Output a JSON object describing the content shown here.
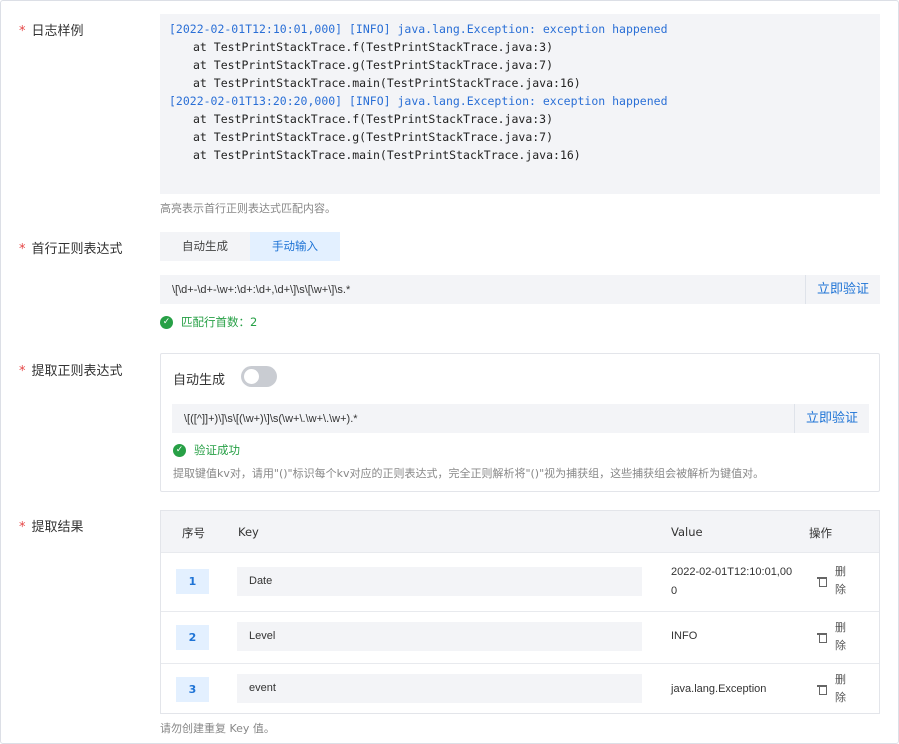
{
  "log_sample": {
    "label": "日志样例",
    "lines": [
      {
        "text": "[2022-02-01T12:10:01,000] [INFO] java.lang.Exception: exception happened",
        "highlight": true
      },
      {
        "text": "at TestPrintStackTrace.f(TestPrintStackTrace.java:3)",
        "highlight": false
      },
      {
        "text": "at TestPrintStackTrace.g(TestPrintStackTrace.java:7)",
        "highlight": false
      },
      {
        "text": "at TestPrintStackTrace.main(TestPrintStackTrace.java:16)",
        "highlight": false
      },
      {
        "text": "[2022-02-01T13:20:20,000] [INFO] java.lang.Exception: exception happened",
        "highlight": true
      },
      {
        "text": "at TestPrintStackTrace.f(TestPrintStackTrace.java:3)",
        "highlight": false
      },
      {
        "text": "at TestPrintStackTrace.g(TestPrintStackTrace.java:7)",
        "highlight": false
      },
      {
        "text": "at TestPrintStackTrace.main(TestPrintStackTrace.java:16)",
        "highlight": false
      }
    ],
    "hint": "高亮表示首行正则表达式匹配内容。"
  },
  "first_line_regex": {
    "label": "首行正则表达式",
    "tabs": [
      {
        "label": "自动生成",
        "active": false
      },
      {
        "label": "手动输入",
        "active": true
      }
    ],
    "value": "\\[\\d+-\\d+-\\w+:\\d+:\\d+,\\d+\\]\\s\\[\\w+\\]\\s.*",
    "verify_label": "立即验证",
    "status": "匹配行首数：2"
  },
  "extract_regex": {
    "label": "提取正则表达式",
    "auto_label": "自动生成",
    "auto_enabled": false,
    "value": "\\[([^]]+)\\]\\s\\[(\\w+)\\]\\s(\\w+\\.\\w+\\.\\w+).*",
    "verify_label": "立即验证",
    "status": "验证成功",
    "hint": "提取键值kv对，请用\"()\"标识每个kv对应的正则表达式，完全正则解析将\"()\"视为捕获组，这些捕获组会被解析为键值对。"
  },
  "extract_result": {
    "label": "提取结果",
    "columns": {
      "index": "序号",
      "key": "Key",
      "value": "Value",
      "action": "操作"
    },
    "rows": [
      {
        "index": "1",
        "key": "Date",
        "value": "2022-02-01T12:10:01,000",
        "action": "删除"
      },
      {
        "index": "2",
        "key": "Level",
        "value": "INFO",
        "action": "删除"
      },
      {
        "index": "3",
        "key": "event",
        "value": "java.lang.Exception",
        "action": "删除"
      }
    ],
    "hint": "请勿创建重复 Key 值。"
  },
  "colors": {
    "accent": "#1f74d6",
    "success": "#27a046",
    "required": "#e54545"
  }
}
